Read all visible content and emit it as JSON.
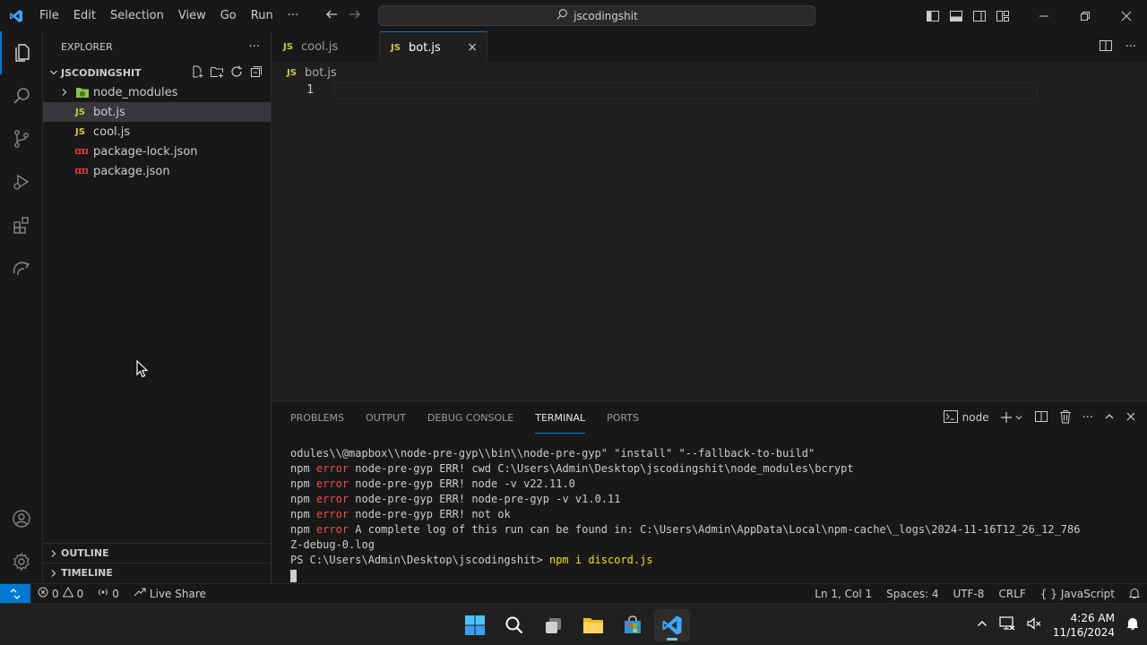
{
  "menu": [
    "File",
    "Edit",
    "Selection",
    "View",
    "Go",
    "Run",
    "···"
  ],
  "search": {
    "text": "jscodingshit"
  },
  "explorer": {
    "title": "EXPLORER",
    "more": "···",
    "folder": "JSCODINGSHIT",
    "items": [
      {
        "label": "node_modules",
        "kind": "folder"
      },
      {
        "label": "bot.js",
        "kind": "js",
        "badge": "JS",
        "selected": true
      },
      {
        "label": "cool.js",
        "kind": "js",
        "badge": "JS"
      },
      {
        "label": "package-lock.json",
        "kind": "json"
      },
      {
        "label": "package.json",
        "kind": "json"
      }
    ],
    "outline": "OUTLINE",
    "timeline": "TIMELINE"
  },
  "tabs": [
    {
      "badge": "JS",
      "label": "cool.js",
      "active": false
    },
    {
      "badge": "JS",
      "label": "bot.js",
      "active": true,
      "close": "×"
    }
  ],
  "tab_more": "···",
  "breadcrumb": {
    "badge": "JS",
    "file": "bot.js"
  },
  "editor": {
    "line_number": "1"
  },
  "panel": {
    "tabs": [
      "PROBLEMS",
      "OUTPUT",
      "DEBUG CONSOLE",
      "TERMINAL",
      "PORTS"
    ],
    "active_tab": "TERMINAL",
    "shell": "node",
    "more": "···",
    "terminal_lines": [
      {
        "plain": "odules\\\\@mapbox\\\\node-pre-gyp\\\\bin\\\\node-pre-gyp\" \"install\" \"--fallback-to-build\""
      },
      {
        "npm": "npm",
        "error": "error",
        "text": " node-pre-gyp ERR! cwd C:\\Users\\Admin\\Desktop\\jscodingshit\\node_modules\\bcrypt"
      },
      {
        "npm": "npm",
        "error": "error",
        "text": " node-pre-gyp ERR! node -v v22.11.0"
      },
      {
        "npm": "npm",
        "error": "error",
        "text": " node-pre-gyp ERR! node-pre-gyp -v v1.0.11"
      },
      {
        "npm": "npm",
        "error": "error",
        "text": " node-pre-gyp ERR! not ok"
      },
      {
        "npm": "npm",
        "error": "error",
        "text": " A complete log of this run can be found in: C:\\Users\\Admin\\AppData\\Local\\npm-cache\\_logs\\2024-11-16T12_26_12_786"
      },
      {
        "plain": "Z-debug-0.log"
      }
    ],
    "prompt": "PS C:\\Users\\Admin\\Desktop\\jscodingshit> ",
    "command": "npm i discord.js"
  },
  "status": {
    "errors": "0",
    "warnings": "0",
    "ports": "0",
    "live_share": "Live Share",
    "position": "Ln 1, Col 1",
    "spaces": "Spaces: 4",
    "encoding": "UTF-8",
    "eol": "CRLF",
    "language": "JavaScript"
  },
  "taskbar": {
    "time": "4:26 AM",
    "date": "11/16/2024"
  },
  "colors": {
    "accent": "#0078d4",
    "js": "#cbcb41",
    "error": "#f14c4c",
    "command": "#e5e510",
    "npm": "#cb3837"
  }
}
